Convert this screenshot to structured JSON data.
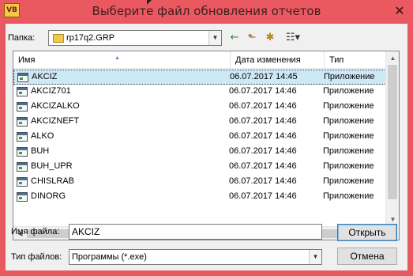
{
  "window": {
    "title": "Выберите файл обновления отчетов",
    "app_icon_text": "VB",
    "close_glyph": "✕"
  },
  "lookin": {
    "label": "Папка:",
    "value": "rp17q2.GRP"
  },
  "toolbar": {
    "back_icon": "back-arrow-icon",
    "up_icon": "up-folder-icon",
    "newfolder_icon": "new-folder-icon",
    "views_icon": "view-menu-icon"
  },
  "columns": {
    "name": "Имя",
    "date": "Дата изменения",
    "type": "Тип"
  },
  "files": [
    {
      "name": "AKCIZ",
      "date": "06.07.2017 14:45",
      "type": "Приложение",
      "selected": true
    },
    {
      "name": "AKCIZ701",
      "date": "06.07.2017 14:46",
      "type": "Приложение"
    },
    {
      "name": "AKCIZALKO",
      "date": "06.07.2017 14:46",
      "type": "Приложение"
    },
    {
      "name": "AKCIZNEFT",
      "date": "06.07.2017 14:46",
      "type": "Приложение"
    },
    {
      "name": "ALKO",
      "date": "06.07.2017 14:46",
      "type": "Приложение"
    },
    {
      "name": "BUH",
      "date": "06.07.2017 14:46",
      "type": "Приложение"
    },
    {
      "name": "BUH_UPR",
      "date": "06.07.2017 14:46",
      "type": "Приложение"
    },
    {
      "name": "CHISLRAB",
      "date": "06.07.2017 14:46",
      "type": "Приложение"
    },
    {
      "name": "DINORG",
      "date": "06.07.2017 14:46",
      "type": "Приложение"
    }
  ],
  "filename": {
    "label": "Имя файла:",
    "value": "AKCIZ"
  },
  "filetype": {
    "label": "Тип файлов:",
    "value": "Программы (*.exe)"
  },
  "buttons": {
    "open": "Открыть",
    "cancel": "Отмена"
  }
}
